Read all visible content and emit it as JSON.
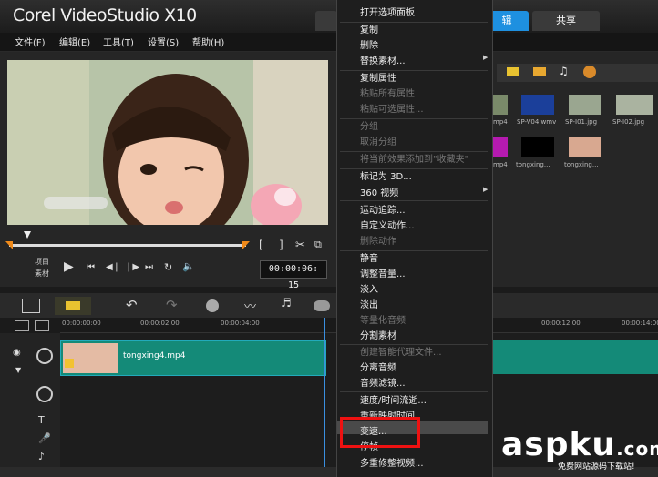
{
  "app": {
    "title": "Corel VideoStudio X10"
  },
  "tabs": {
    "edit": "辑",
    "share": "共享"
  },
  "menu": [
    "文件(F)",
    "编辑(E)",
    "工具(T)",
    "设置(S)",
    "帮助(H)"
  ],
  "player": {
    "mode_project": "项目",
    "mode_clip": "素材",
    "timecode": "00:00:06: 15"
  },
  "library": {
    "thumbs_row1": [
      "mp4",
      "SP-V04.wmv",
      "SP-I01.jpg",
      "SP-I02.jpg"
    ],
    "thumbs_row2": [
      "mp4",
      "tongxing...",
      "tongxing..."
    ]
  },
  "ruler": [
    "00:00:00:00",
    "00:00:02:00",
    "00:00:04:00",
    "00:00:12:00",
    "00:00:14:00"
  ],
  "clip": {
    "name": "tongxing4.mp4"
  },
  "context_menu": {
    "items": [
      {
        "label": "打开选项面板",
        "enabled": true
      },
      {
        "label": "复制",
        "enabled": true
      },
      {
        "label": "删除",
        "enabled": true
      },
      {
        "label": "替换素材...",
        "enabled": true,
        "submenu": true
      },
      {
        "label": "复制属性",
        "enabled": true
      },
      {
        "label": "粘贴所有属性",
        "enabled": false
      },
      {
        "label": "粘贴可选属性...",
        "enabled": false
      },
      {
        "label": "分组",
        "enabled": false
      },
      {
        "label": "取消分组",
        "enabled": false
      },
      {
        "label": "将当前效果添加到\"收藏夹\"",
        "enabled": false
      },
      {
        "label": "标记为 3D...",
        "enabled": true
      },
      {
        "label": "360 视频",
        "enabled": true,
        "submenu": true
      },
      {
        "label": "运动追踪...",
        "enabled": true
      },
      {
        "label": "自定义动作...",
        "enabled": true
      },
      {
        "label": "删除动作",
        "enabled": false
      },
      {
        "label": "静音",
        "enabled": true
      },
      {
        "label": "调整音量...",
        "enabled": true
      },
      {
        "label": "淡入",
        "enabled": true
      },
      {
        "label": "淡出",
        "enabled": true
      },
      {
        "label": "等量化音频",
        "enabled": false
      },
      {
        "label": "分割素材",
        "enabled": true
      },
      {
        "label": "创建智能代理文件...",
        "enabled": false
      },
      {
        "label": "分离音频",
        "enabled": true
      },
      {
        "label": "音频滤镜...",
        "enabled": true
      },
      {
        "label": "速度/时间流逝...",
        "enabled": true
      },
      {
        "label": "重新映射时间",
        "enabled": true
      },
      {
        "label": "变速...",
        "enabled": true,
        "highlighted": true
      },
      {
        "label": "停帧",
        "enabled": true
      },
      {
        "label": "多重修整视频...",
        "enabled": true
      }
    ]
  },
  "watermark": {
    "main": "aspku",
    "suffix": ".com",
    "sub": "免费网站源码下载站!"
  },
  "colors": {
    "accent": "#1e90e0",
    "clip": "#148a78",
    "highlight_box": "#e11111"
  }
}
